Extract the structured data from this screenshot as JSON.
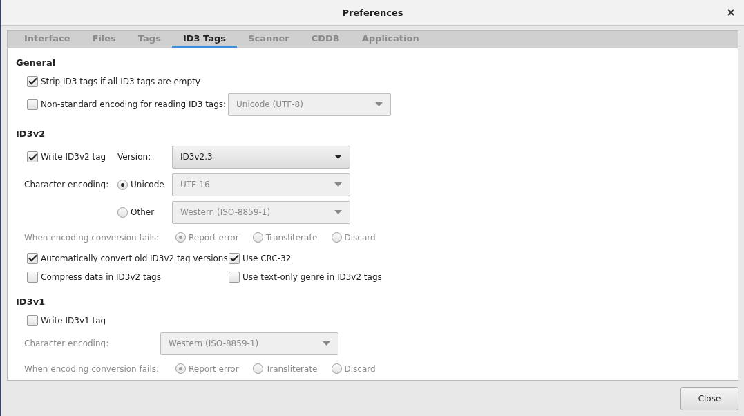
{
  "window": {
    "title": "Preferences"
  },
  "tabs": [
    {
      "label": "Interface",
      "selected": false
    },
    {
      "label": "Files",
      "selected": false
    },
    {
      "label": "Tags",
      "selected": false
    },
    {
      "label": "ID3 Tags",
      "selected": true
    },
    {
      "label": "Scanner",
      "selected": false
    },
    {
      "label": "CDDB",
      "selected": false
    },
    {
      "label": "Application",
      "selected": false
    }
  ],
  "sections": [
    {
      "title": "General",
      "rows": [
        {
          "kind": "check",
          "label": "Strip ID3 tags if all ID3 tags are empty",
          "checked": true
        },
        {
          "kind": "check_combo",
          "label": "Non-standard encoding for reading ID3 tags:",
          "checked": false,
          "combo": {
            "value": "Unicode (UTF-8)",
            "disabled": true
          }
        }
      ]
    },
    {
      "title": "ID3v2",
      "rows": [
        {
          "kind": "check_combo",
          "label": "Write ID3v2 tag",
          "checked": true,
          "combo_label": "Version:",
          "combo": {
            "value": "ID3v2.3",
            "disabled": false
          }
        },
        {
          "kind": "radio_combo",
          "label": "Character encoding:",
          "radio": {
            "label": "Unicode",
            "selected": true
          },
          "combo": {
            "value": "UTF-16",
            "disabled": true
          }
        },
        {
          "kind": "radio_combo",
          "radio": {
            "label": "Other",
            "selected": false
          },
          "combo": {
            "value": "Western (ISO-8859-1)",
            "disabled": true
          }
        },
        {
          "kind": "radios",
          "label": "When encoding conversion fails:",
          "disabled": true,
          "options": [
            {
              "label": "Report error",
              "selected": true
            },
            {
              "label": "Transliterate",
              "selected": false
            },
            {
              "label": "Discard",
              "selected": false
            }
          ]
        },
        {
          "kind": "check_pair",
          "items": [
            {
              "label": "Automatically convert old ID3v2 tag versions",
              "checked": true
            },
            {
              "label": "Use CRC-32",
              "checked": true
            }
          ]
        },
        {
          "kind": "check_pair",
          "items": [
            {
              "label": "Compress data in ID3v2 tags",
              "checked": false
            },
            {
              "label": "Use text-only genre in ID3v2 tags",
              "checked": false
            }
          ]
        }
      ]
    },
    {
      "title": "ID3v1",
      "rows": [
        {
          "kind": "check",
          "label": "Write ID3v1 tag",
          "checked": false
        },
        {
          "kind": "label_combo",
          "label": "Character encoding:",
          "disabled": true,
          "combo": {
            "value": "Western (ISO-8859-1)",
            "disabled": true
          }
        },
        {
          "kind": "radios",
          "label": "When encoding conversion fails:",
          "disabled": true,
          "options": [
            {
              "label": "Report error",
              "selected": true
            },
            {
              "label": "Transliterate",
              "selected": false
            },
            {
              "label": "Discard",
              "selected": false
            }
          ]
        }
      ]
    }
  ],
  "buttons": [
    "Close"
  ]
}
